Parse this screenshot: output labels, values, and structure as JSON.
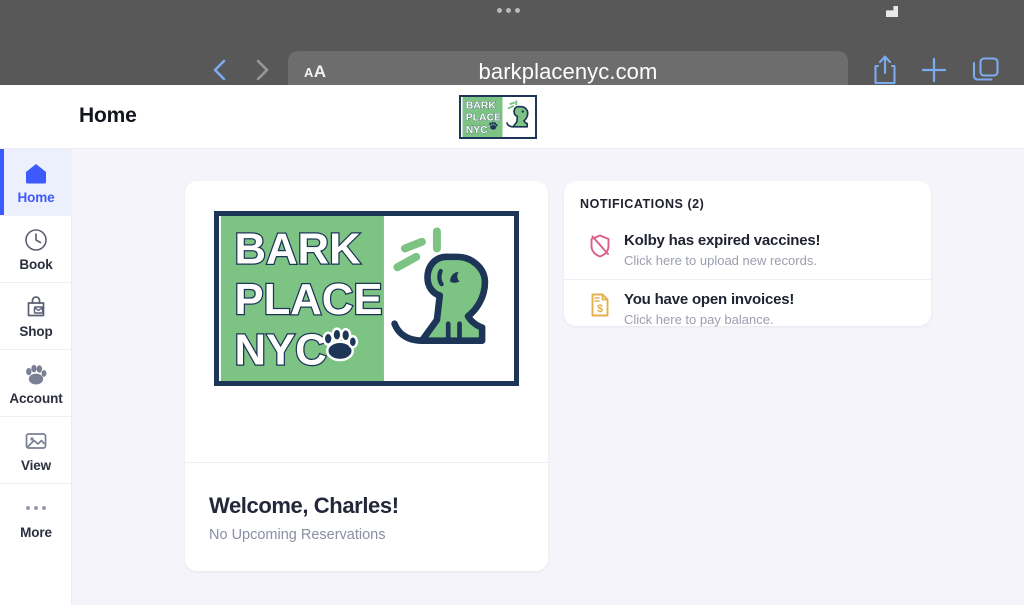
{
  "browser": {
    "url": "barkplacenyc.com",
    "text_size_small": "A",
    "text_size_large": "A",
    "back_label": "Back",
    "forward_label": "Forward",
    "share_label": "Share",
    "new_tab_label": "New Tab",
    "tabs_label": "Show Tabs",
    "chrome_bg": "#585858",
    "url_field_bg": "#6d6d6d",
    "accent": "#7eaaf0"
  },
  "header": {
    "title": "Home",
    "logo_line1": "BARK",
    "logo_line2": "PLACE",
    "logo_line3": "NYC"
  },
  "sidebar": {
    "active_color": "#3d5afe",
    "items": [
      {
        "label": "Home",
        "icon": "home-icon",
        "active": true
      },
      {
        "label": "Book",
        "icon": "clock-icon",
        "active": false
      },
      {
        "label": "Shop",
        "icon": "bag-icon",
        "active": false
      },
      {
        "label": "Account",
        "icon": "paw-icon",
        "active": false
      },
      {
        "label": "View",
        "icon": "photo-icon",
        "active": false
      },
      {
        "label": "More",
        "icon": "ellipsis-icon",
        "active": false
      }
    ]
  },
  "main": {
    "logo": {
      "line1": "BARK",
      "line2": "PLACE",
      "line3": "NYC",
      "green": "#7dc383",
      "navy": "#1d3557"
    },
    "welcome_title": "Welcome, Charles!",
    "welcome_subtitle": "No Upcoming Reservations"
  },
  "notifications": {
    "heading": "NOTIFICATIONS (2)",
    "count": 2,
    "items": [
      {
        "title": "Kolby  has expired vaccines!",
        "subtitle": "Click here to upload new records.",
        "icon": "shield-slash-icon",
        "color": "#dd5f86"
      },
      {
        "title": "You have open invoices!",
        "subtitle": "Click here to pay balance.",
        "icon": "invoice-dollar-icon",
        "color": "#e3b04b"
      }
    ]
  }
}
